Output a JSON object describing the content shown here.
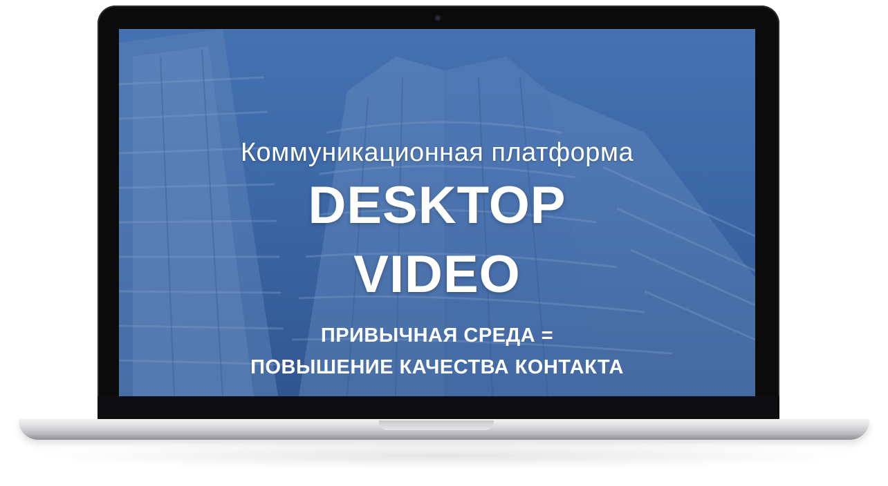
{
  "screen": {
    "subtitle": "Коммуникационная платформа",
    "title_line1": "DESKTOP",
    "title_line2": "VIDEO",
    "tagline_line1": "ПРИВЫЧНАЯ СРЕДА  =",
    "tagline_line2": "ПОВЫШЕНИЕ КАЧЕСТВА  КОНТАКТА"
  },
  "colors": {
    "overlay_blue": "#3f6aa8",
    "bezel": "#0b0b0c",
    "text": "#ffffff"
  },
  "icons": [
    "camera-icon"
  ]
}
